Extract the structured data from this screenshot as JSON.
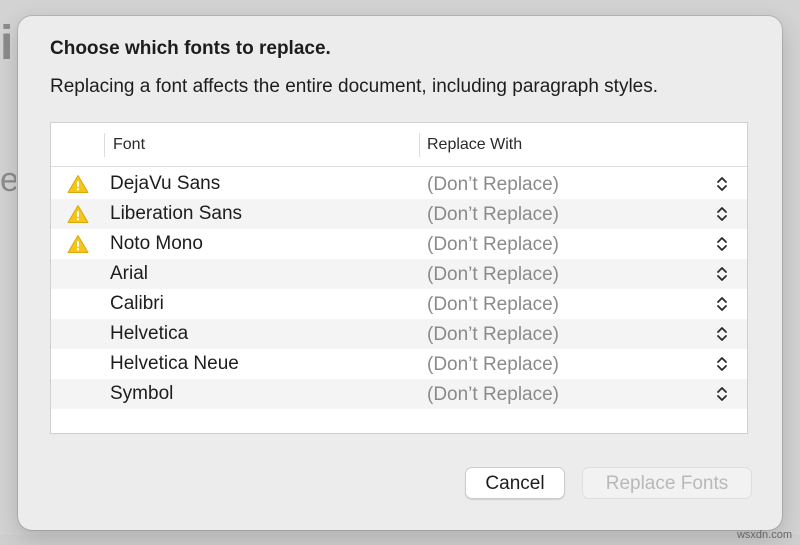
{
  "dialog": {
    "title": "Choose which fonts to replace.",
    "description": "Replacing a font affects the entire document, including paragraph styles.",
    "columns": {
      "font": "Font",
      "replace_with": "Replace With"
    },
    "rows": [
      {
        "font": "DejaVu Sans",
        "warning": true,
        "replace_with": "(Don’t Replace)"
      },
      {
        "font": "Liberation Sans",
        "warning": true,
        "replace_with": "(Don’t Replace)"
      },
      {
        "font": "Noto Mono",
        "warning": true,
        "replace_with": "(Don’t Replace)"
      },
      {
        "font": "Arial",
        "warning": false,
        "replace_with": "(Don’t Replace)"
      },
      {
        "font": "Calibri",
        "warning": false,
        "replace_with": "(Don’t Replace)"
      },
      {
        "font": "Helvetica",
        "warning": false,
        "replace_with": "(Don’t Replace)"
      },
      {
        "font": "Helvetica Neue",
        "warning": false,
        "replace_with": "(Don’t Replace)"
      },
      {
        "font": "Symbol",
        "warning": false,
        "replace_with": "(Don’t Replace)"
      }
    ],
    "buttons": {
      "cancel": "Cancel",
      "replace": "Replace Fonts"
    }
  },
  "colors": {
    "warning_icon": "#f5c518",
    "disabled_text": "#b9b9b9"
  },
  "icons": {
    "warning": "warning-triangle-icon",
    "stepper": "up-down-chevron-icon"
  },
  "background": {
    "glyph_top": "i",
    "glyph_mid": "e"
  },
  "watermark": "wsxdn.com"
}
